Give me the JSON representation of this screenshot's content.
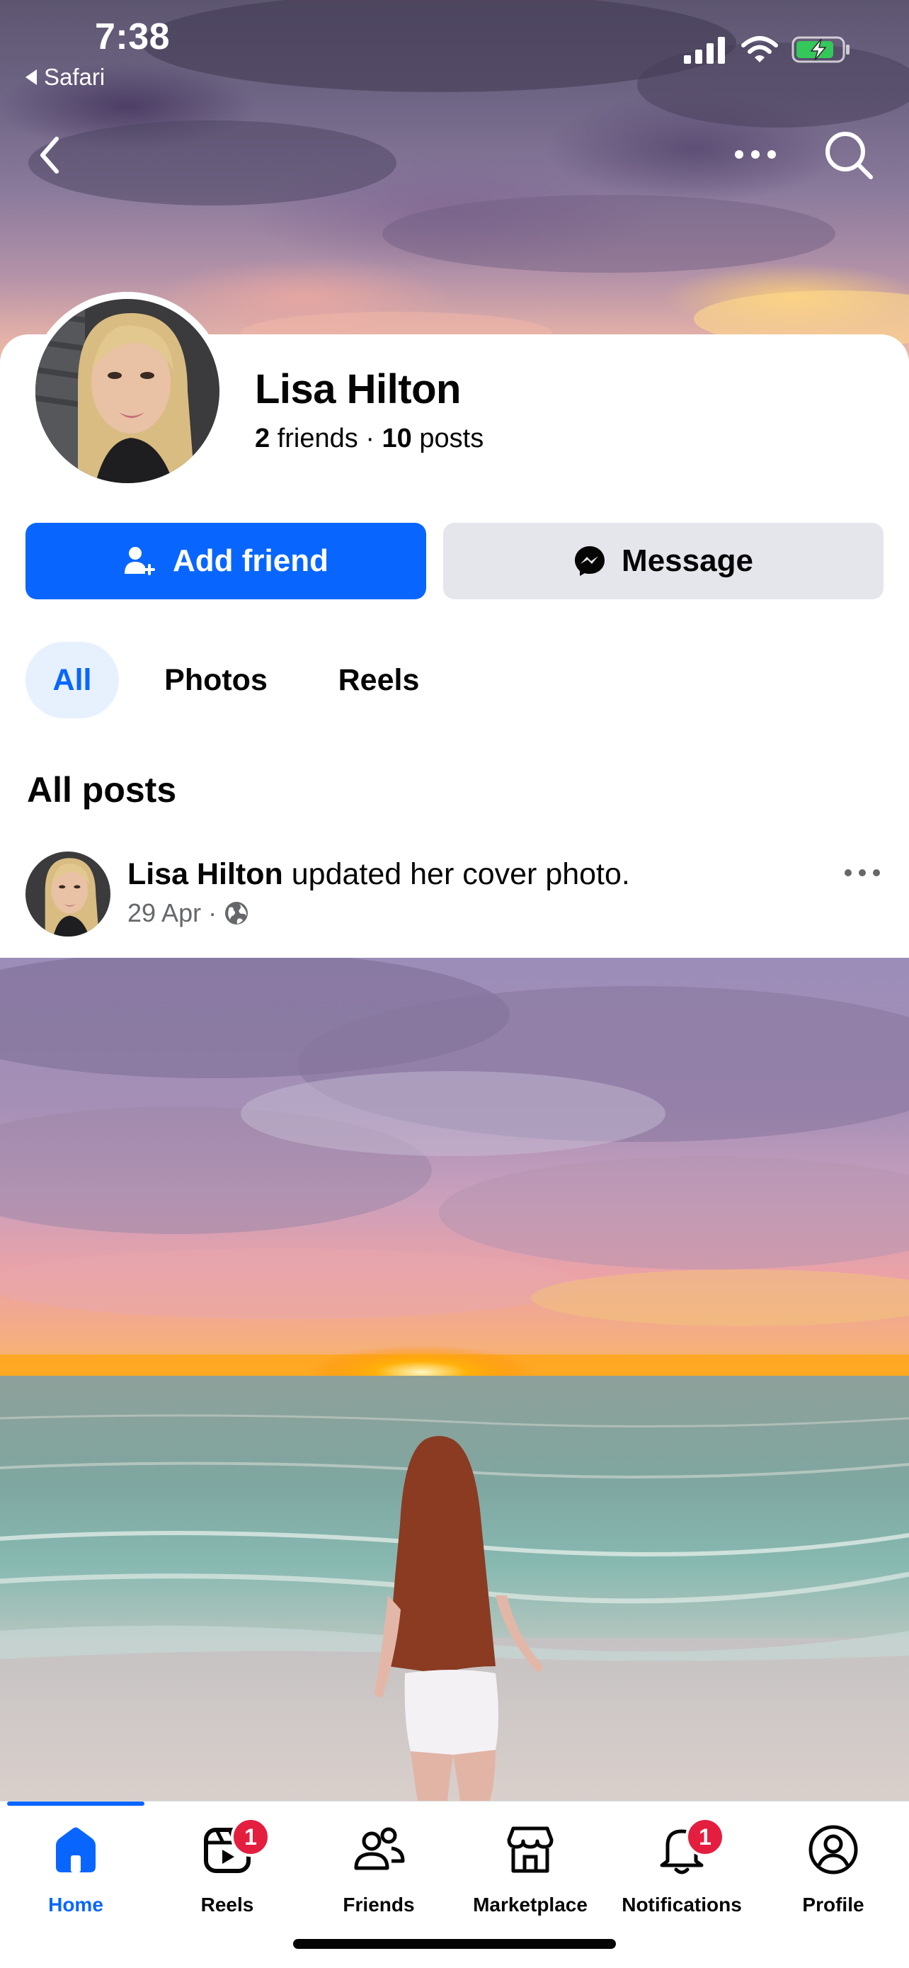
{
  "status_bar": {
    "time": "7:38",
    "back_app": "Safari"
  },
  "profile": {
    "name": "Lisa Hilton",
    "friends_count": "2",
    "friends_label": "friends",
    "separator": "·",
    "posts_count": "10",
    "posts_label": "posts"
  },
  "actions": {
    "add_friend": "Add friend",
    "message": "Message"
  },
  "tabs": [
    {
      "label": "All",
      "active": true
    },
    {
      "label": "Photos",
      "active": false
    },
    {
      "label": "Reels",
      "active": false
    }
  ],
  "posts_section_title": "All posts",
  "post": {
    "author": "Lisa Hilton",
    "action_text": " updated her cover photo.",
    "date": "29 Apr",
    "dot": "·",
    "visibility_icon": "globe-icon"
  },
  "bottom_nav": [
    {
      "label": "Home",
      "icon": "home-icon",
      "active": true,
      "badge": ""
    },
    {
      "label": "Reels",
      "icon": "reels-icon",
      "active": false,
      "badge": "1"
    },
    {
      "label": "Friends",
      "icon": "friends-icon",
      "active": false,
      "badge": ""
    },
    {
      "label": "Marketplace",
      "icon": "marketplace-icon",
      "active": false,
      "badge": ""
    },
    {
      "label": "Notifications",
      "icon": "bell-icon",
      "active": false,
      "badge": "1"
    },
    {
      "label": "Profile",
      "icon": "profile-icon",
      "active": false,
      "badge": ""
    }
  ],
  "colors": {
    "accent": "#0866ff",
    "secondary_button": "#e4e6eb",
    "active_tab_bg": "#e7f1fe",
    "badge": "#e41e3f",
    "muted_text": "#65676b"
  }
}
